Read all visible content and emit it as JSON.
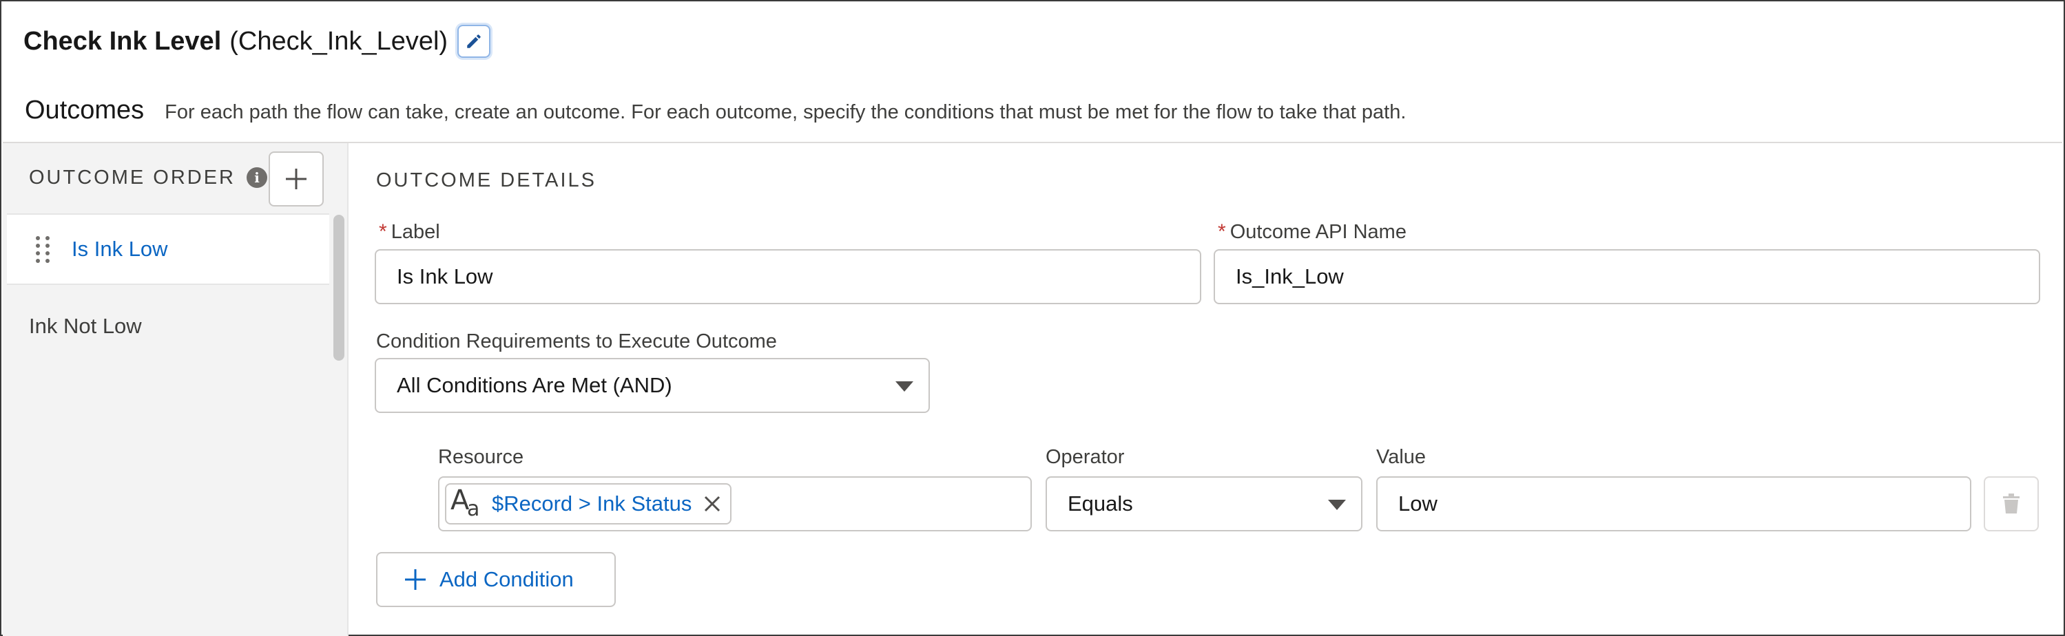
{
  "header": {
    "element_label": "Check Ink Level",
    "element_api_name": "(Check_Ink_Level)"
  },
  "outcomes": {
    "title": "Outcomes",
    "description": "For each path the flow can take, create an outcome. For each outcome, specify the conditions that must be met for the flow to take that path."
  },
  "sidebar": {
    "header_label": "OUTCOME ORDER",
    "info_glyph": "i",
    "items": [
      {
        "label": "Is Ink Low",
        "selected": true
      },
      {
        "label": "Ink Not Low",
        "selected": false
      }
    ]
  },
  "details": {
    "section_title": "OUTCOME DETAILS",
    "label_field": {
      "label": "Label",
      "required_mark": "*",
      "value": "Is Ink Low"
    },
    "api_name_field": {
      "label": "Outcome API Name",
      "required_mark": "*",
      "value": "Is_Ink_Low"
    },
    "condition_requirements": {
      "label": "Condition Requirements to Execute Outcome",
      "selected": "All Conditions Are Met (AND)"
    },
    "condition": {
      "resource_label": "Resource",
      "resource_value": "$Record > Ink Status",
      "operator_label": "Operator",
      "operator_value": "Equals",
      "value_label": "Value",
      "value_value": "Low"
    },
    "add_condition_label": "Add Condition"
  },
  "icons": {
    "edit": "pencil-icon",
    "info": "info-icon",
    "add": "plus-icon",
    "drag": "drag-handle-icon",
    "text_type": "text-type-icon",
    "remove": "close-icon",
    "delete": "trash-icon",
    "dropdown": "chevron-down-icon"
  },
  "colors": {
    "link_blue": "#0b66c3",
    "required_red": "#c23934",
    "sidebar_bg": "#f3f3f3",
    "border": "#c9c7c5"
  }
}
